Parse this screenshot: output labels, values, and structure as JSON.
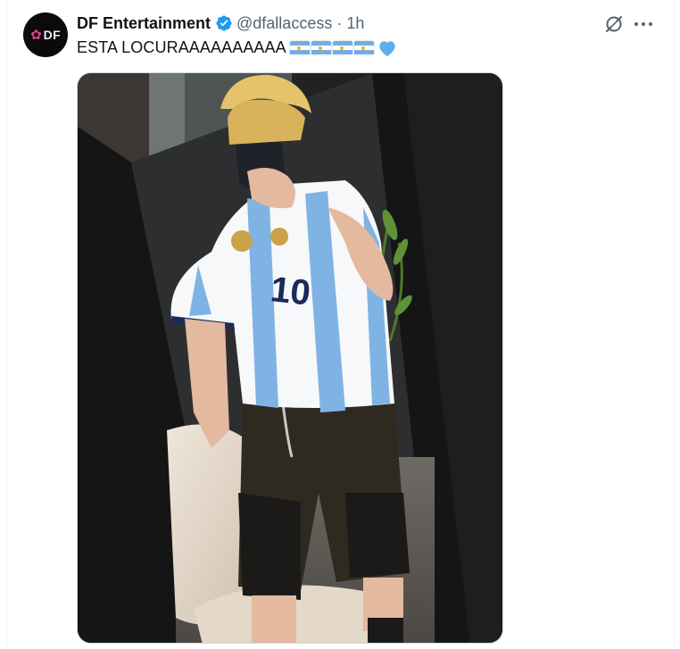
{
  "tweet": {
    "author_name": "DF Entertainment",
    "verified": true,
    "handle": "@dfallaccess",
    "separator": "·",
    "time": "1h",
    "text": "ESTA LOCURAAAAAAAAAA",
    "emoji": [
      "argentina-flag",
      "argentina-flag",
      "argentina-flag",
      "argentina-flag",
      "blue-heart"
    ],
    "avatar_text": "DF"
  },
  "icons": {
    "grok": "grok-icon",
    "more": "more-icon",
    "verified": "verified-badge-icon"
  },
  "colors": {
    "verified_blue": "#1d9bf0",
    "text_primary": "#0f1419",
    "text_secondary": "#536471",
    "avatar_accent": "#e0428a",
    "flag_blue": "#74acdf",
    "heart_blue": "#5dadec"
  },
  "media": {
    "description": "photo",
    "jersey_number": "10"
  }
}
